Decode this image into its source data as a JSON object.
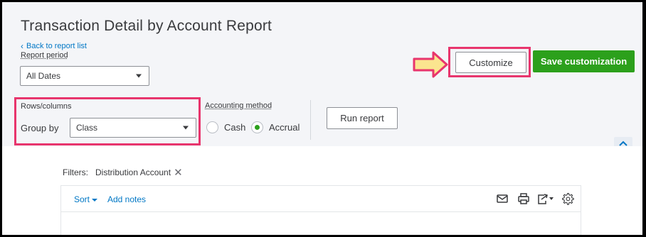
{
  "header": {
    "title": "Transaction Detail by Account Report",
    "back_link": "Back to report list"
  },
  "report_period": {
    "label": "Report period",
    "value": "All Dates"
  },
  "rows_columns": {
    "label": "Rows/columns",
    "group_by_label": "Group by",
    "group_by_value": "Class"
  },
  "accounting_method": {
    "label": "Accounting method",
    "options": [
      "Cash",
      "Accrual"
    ],
    "selected": "Accrual"
  },
  "buttons": {
    "run_report": "Run report",
    "customize": "Customize",
    "save_customization": "Save customization"
  },
  "filters": {
    "label": "Filters:",
    "items": [
      "Distribution Account"
    ]
  },
  "toolbar": {
    "sort": "Sort",
    "add_notes": "Add notes"
  },
  "colors": {
    "accent_green": "#2ca01c",
    "link_blue": "#0077c5",
    "highlight_pink": "#e8356d",
    "arrow_yellow": "#fbe58f"
  },
  "icons": [
    "chevron-left-icon",
    "caret-down-icon",
    "arrow-right-icon",
    "chevron-up-icon",
    "close-icon",
    "email-icon",
    "print-icon",
    "export-icon",
    "gear-icon"
  ]
}
